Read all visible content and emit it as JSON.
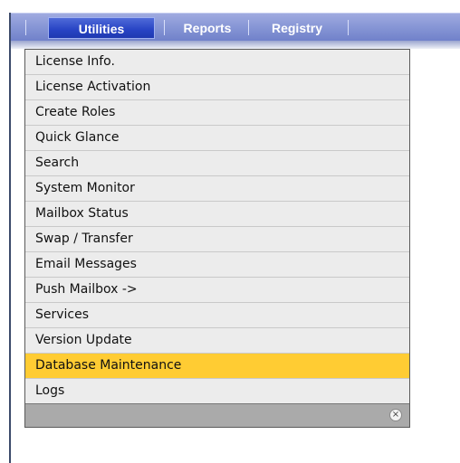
{
  "menubar": {
    "tabs": [
      {
        "label": "Utilities"
      },
      {
        "label": "Reports"
      },
      {
        "label": "Registry"
      }
    ]
  },
  "dropdown": {
    "items": [
      {
        "label": "License Info."
      },
      {
        "label": "License Activation"
      },
      {
        "label": "Create Roles"
      },
      {
        "label": "Quick Glance"
      },
      {
        "label": "Search"
      },
      {
        "label": "System Monitor"
      },
      {
        "label": "Mailbox Status"
      },
      {
        "label": "Swap / Transfer"
      },
      {
        "label": "Email Messages"
      },
      {
        "label": "Push Mailbox ->"
      },
      {
        "label": "Services"
      },
      {
        "label": "Version Update"
      },
      {
        "label": "Database Maintenance"
      },
      {
        "label": "Logs"
      }
    ],
    "highlighted_index": 12,
    "close_glyph": "×"
  },
  "colors": {
    "menubar": "#8897d6",
    "active_tab": "#2743c4",
    "highlight": "#ffcc33",
    "dropdown_bg": "#ececec"
  }
}
